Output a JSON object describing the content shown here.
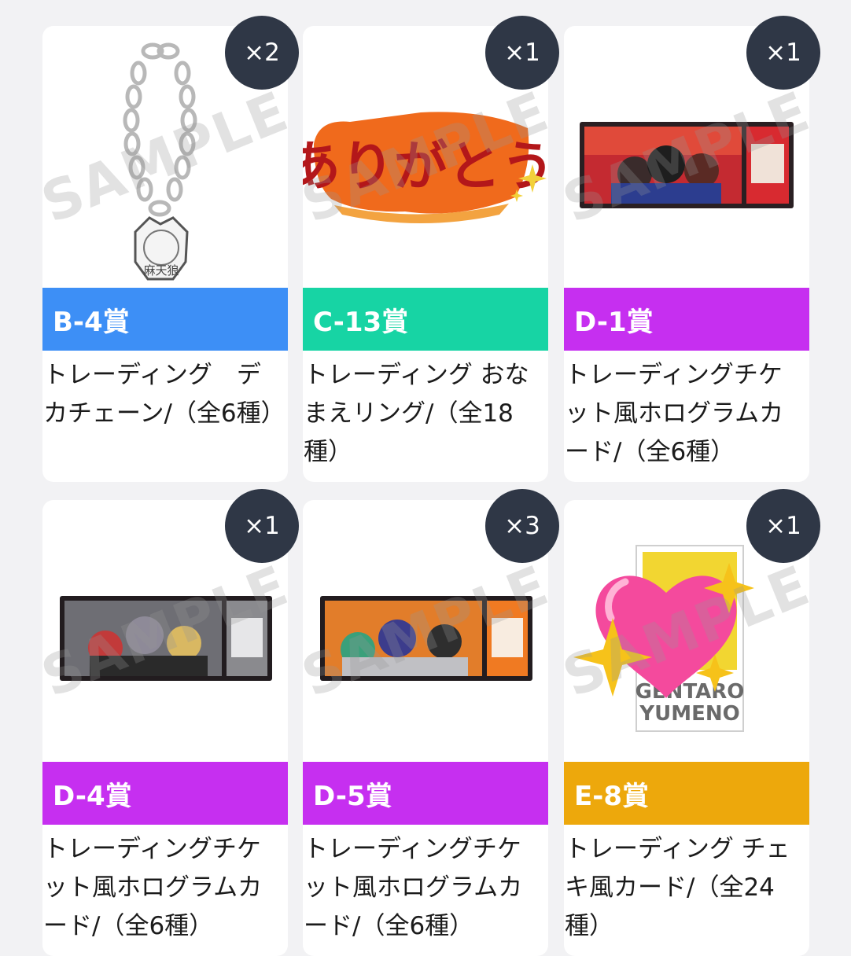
{
  "colors": {
    "blue": "#3d8ff6",
    "green": "#17d4a4",
    "purple": "#c62ff0",
    "gold": "#eda80c",
    "badge": "#2f3746"
  },
  "watermark": "SAMPLE",
  "items": [
    {
      "qty": "×2",
      "prize": "B-4賞",
      "desc": "トレーディング　デカチェーン/（全6種）",
      "color": "#3d8ff6",
      "art": "chain-charm"
    },
    {
      "qty": "×1",
      "prize": "C-13賞",
      "desc": "トレーディング おなまえリング/（全18種）",
      "color": "#17d4a4",
      "art": "name-ring"
    },
    {
      "qty": "×1",
      "prize": "D-1賞",
      "desc": "トレーディングチケット風ホログラムカード/（全6種）",
      "color": "#c62ff0",
      "art": "ticket-card"
    },
    {
      "qty": "×1",
      "prize": "D-4賞",
      "desc": "トレーディングチケット風ホログラムカード/（全6種）",
      "color": "#c62ff0",
      "art": "ticket-card"
    },
    {
      "qty": "×3",
      "prize": "D-5賞",
      "desc": "トレーディングチケット風ホログラムカード/（全6種）",
      "color": "#c62ff0",
      "art": "ticket-card"
    },
    {
      "qty": "×1",
      "prize": "E-8賞",
      "desc": "トレーディング チェキ風カード/（全24種）",
      "color": "#eda80c",
      "art": "cheki-card"
    }
  ],
  "art_text": {
    "ring_word": "ありがとう",
    "cheki_name1": "GENTARO",
    "cheki_name2": "YUMENO"
  }
}
